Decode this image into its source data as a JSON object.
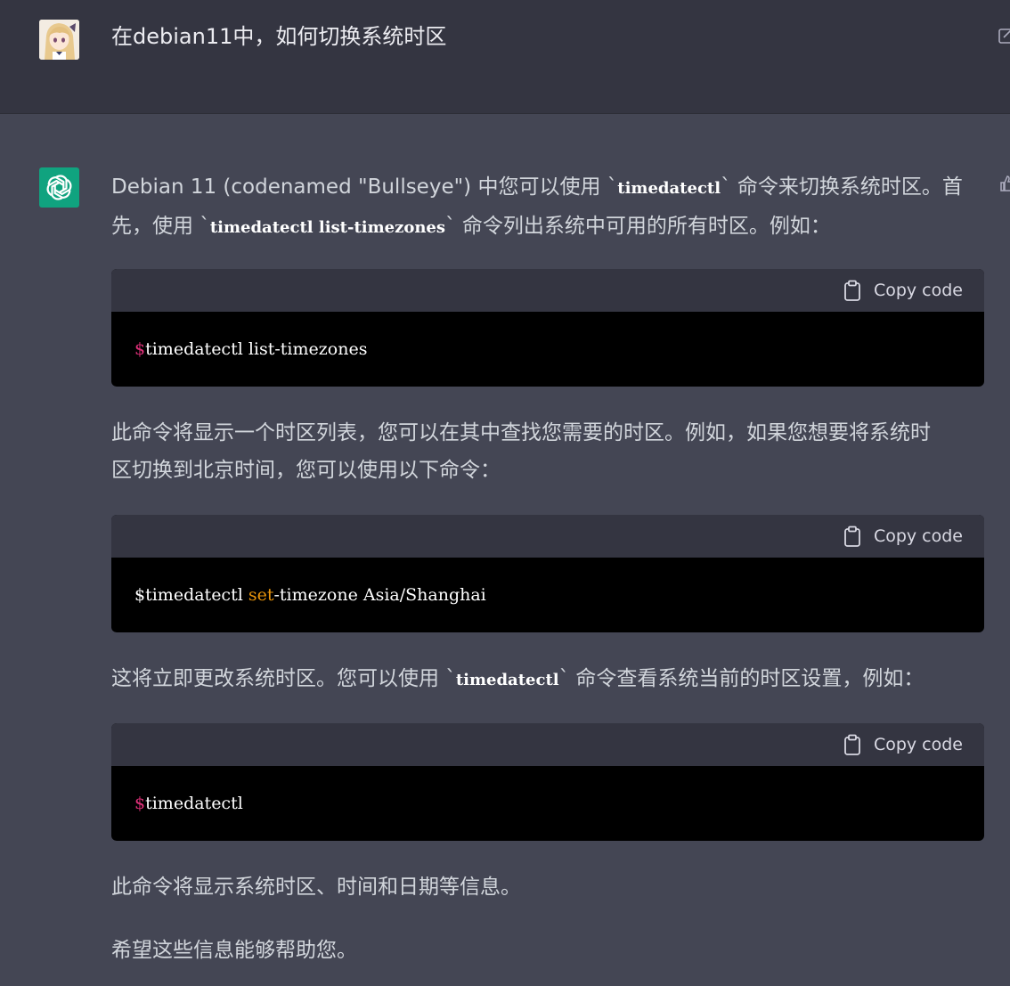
{
  "user": {
    "message": "在debian11中，如何切换系统时区",
    "avatar_icon": "anime-avatar"
  },
  "assistant": {
    "avatar_icon": "openai-logo-icon",
    "avatar_color": "#10a37f",
    "intro": {
      "part1": "Debian 11 (codenamed \"Bullseye\") 中您可以使用 `",
      "code1": "timedatectl",
      "part2": "` 命令来切换系统时区。首",
      "part3": "先，使用 `",
      "code2": "timedatectl list-timezones",
      "part4": "` 命令列出系统中可用的所有时区。例如："
    },
    "code_blocks": [
      {
        "copy_label": "Copy code",
        "prompt": "$",
        "command": "timedatectl list-timezones"
      },
      {
        "copy_label": "Copy code",
        "prompt": "$",
        "cmd_a": "timedatectl ",
        "keyword": "set",
        "cmd_b": "-timezone Asia/Shanghai"
      },
      {
        "copy_label": "Copy code",
        "prompt": "$",
        "command": "timedatectl"
      }
    ],
    "para2": {
      "line1": "此命令将显示一个时区列表，您可以在其中查找您需要的时区。例如，如果您想要将系统时",
      "line2": "区切换到北京时间，您可以使用以下命令："
    },
    "para3": {
      "part1": "这将立即更改系统时区。您可以使用 `",
      "code": "timedatectl",
      "part2": "` 命令查看系统当前的时区设置，例如："
    },
    "para4": "此命令将显示系统时区、时间和日期等信息。",
    "para5": "希望这些信息能够帮助您。"
  },
  "colors": {
    "user_row_bg": "#343541",
    "bot_row_bg": "#444654",
    "code_header_bg": "#343541",
    "code_body_bg": "#000000",
    "prompt_red": "#df3079",
    "keyword_orange": "#e9950c"
  }
}
